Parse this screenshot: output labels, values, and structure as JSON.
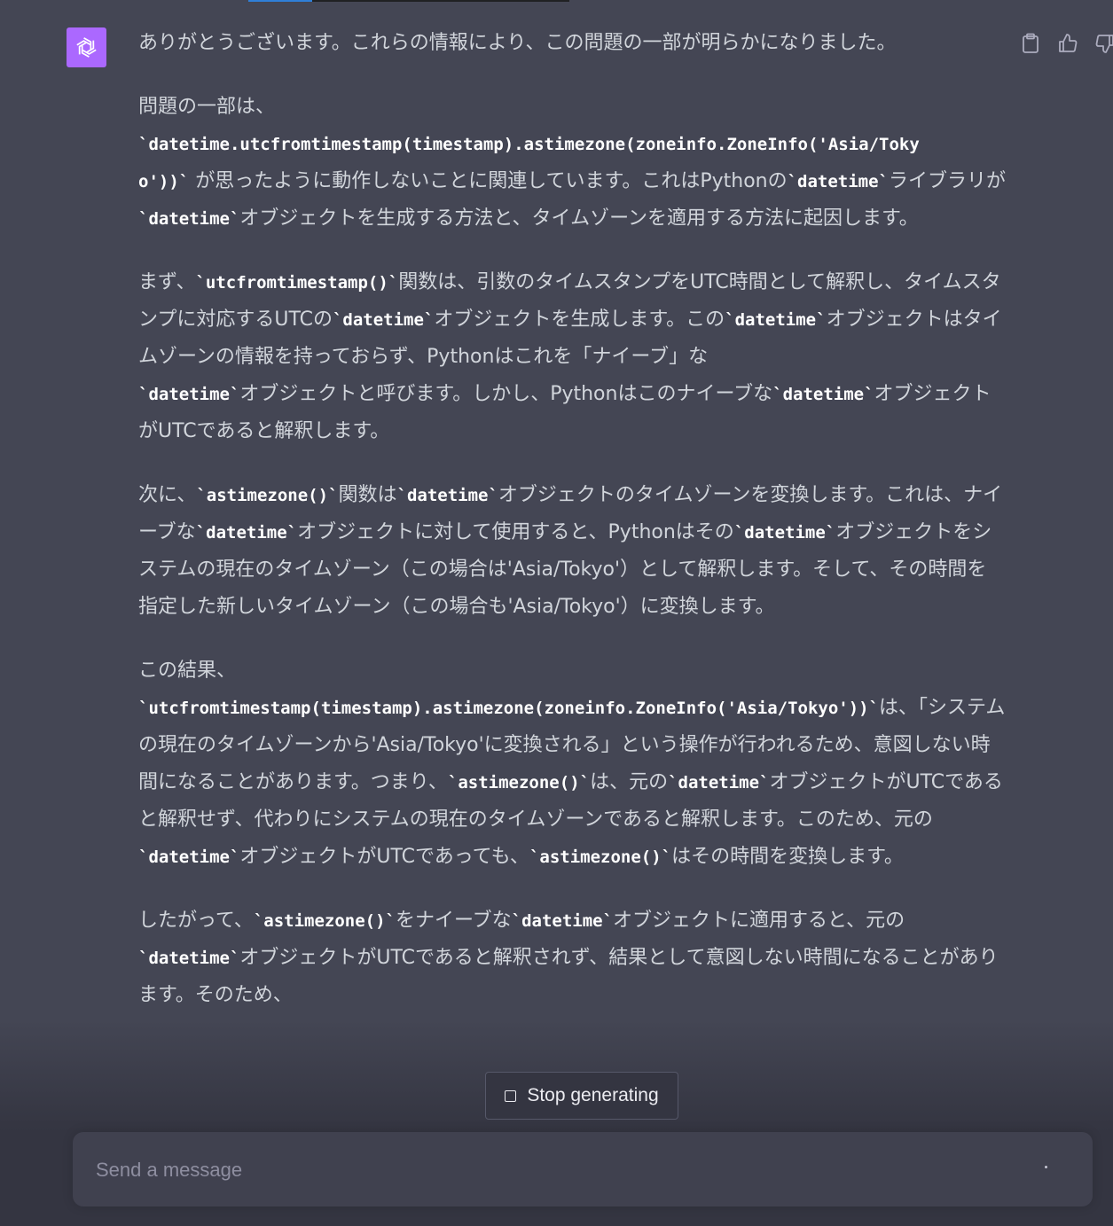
{
  "message": {
    "p1": "ありがとうございます。これらの情報により、この問題の一部が明らかになりました。",
    "p2": {
      "t1": "問題の一部は、",
      "c1a": "`datetime.utcfromtimestamp(timestamp).astimezone(zoneinfo.ZoneInfo('Asia/Toky",
      "c1b": "o'))`",
      "t2": " が思ったように動作しないことに関連しています。これはPythonの",
      "c2": "`datetime`",
      "t3": "ライブラリが",
      "c3": "`datetime`",
      "t4": "オブジェクトを生成する方法と、タイムゾーンを適用する方法に起因します。"
    },
    "p3": {
      "t1": "まず、",
      "c1": "`utcfromtimestamp()`",
      "t2": "関数は、引数のタイムスタンプをUTC時間として解釈し、タイムスタンプに対応するUTCの",
      "c2": "`datetime`",
      "t3": "オブジェクトを生成します。この",
      "c3": "`datetime`",
      "t4": "オブジェクトはタイムゾーンの情報を持っておらず、Pythonはこれを「ナイーブ」な",
      "c4": "`datetime`",
      "t5": "オブジェクトと呼びます。しかし、Pythonはこのナイーブな",
      "c5": "`datetime`",
      "t6": "オブジェクトがUTCであると解釈します。"
    },
    "p4": {
      "t1": "次に、",
      "c1": "`astimezone()`",
      "t2": "関数は",
      "c2": "`datetime`",
      "t3": "オブジェクトのタイムゾーンを変換します。これは、ナイーブな",
      "c3": "`datetime`",
      "t4": "オブジェクトに対して使用すると、Pythonはその",
      "c4": "`datetime`",
      "t5": "オブジェクトをシステムの現在のタイムゾーン（この場合は'Asia/Tokyo'）として解釈します。そして、その時間を指定した新しいタイムゾーン（この場合も'Asia/Tokyo'）に変換します。"
    },
    "p5": {
      "t1": "この結果、",
      "c1": "`utcfromtimestamp(timestamp).astimezone(zoneinfo.ZoneInfo('Asia/Tokyo'))`",
      "t2": "は、「システムの現在のタイムゾーンから'Asia/Tokyo'に変換される」という操作が行われるため、意図しない時間になることがあります。つまり、",
      "c2": "`astimezone()`",
      "t3": "は、元の",
      "c3": "`datetime`",
      "t4": "オブジェクトがUTCであると解釈せず、代わりにシステムの現在のタイムゾーンであると解釈します。このため、元の",
      "c4": "`datetime`",
      "t5": "オブジェクトがUTCであっても、",
      "c5": "`astimezone()`",
      "t6": "はその時間を変換します。"
    },
    "p6": {
      "t1": "したがって、",
      "c1": "`astimezone()`",
      "t2": "をナイーブな",
      "c2": "`datetime`",
      "t3": "オブジェクトに適用すると、元の",
      "c3": "`datetime`",
      "t4": "オブジェクトがUTCであると解釈されず、結果として意図しない時間になることがあります。そのため、"
    }
  },
  "stop_button": {
    "label": "Stop generating"
  },
  "composer": {
    "placeholder": "Send a message",
    "value": ""
  },
  "colors": {
    "avatar_bg": "#ab68ff",
    "accent": "#2f7fd8",
    "background": "#444654"
  },
  "icons": [
    "openai-logo-icon",
    "copy-icon",
    "thumbs-up-icon",
    "thumbs-down-icon",
    "stop-icon"
  ]
}
